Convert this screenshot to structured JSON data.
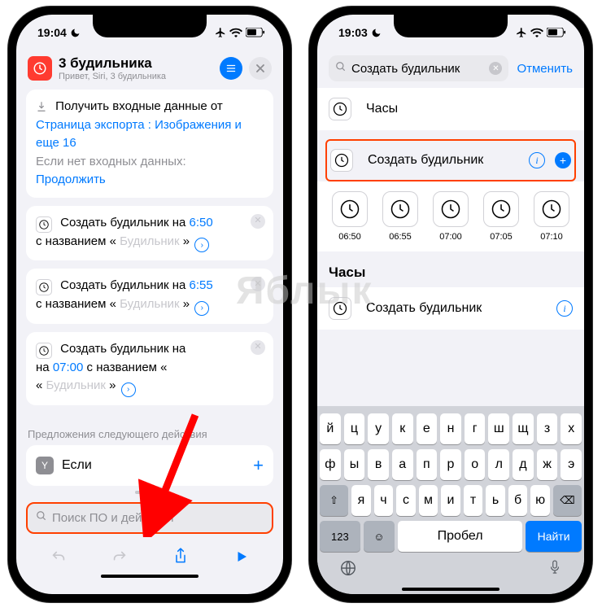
{
  "phone1": {
    "status_time": "19:04",
    "title": "3 будильника",
    "subtitle": "Привет, Siri, 3 будильника",
    "card_intro": {
      "label_get": "Получить входные данные от",
      "source": "Страница экспорта",
      "sep": ":",
      "types": "Изображения и еще 16",
      "no_input": "Если нет входных данных:",
      "cont": "Продолжить"
    },
    "alarm_cards": [
      {
        "pre": "Создать будильник на",
        "time": "6:50",
        "mid": "с названием «",
        "name": "Будильник",
        "end": "»"
      },
      {
        "pre": "Создать будильник на",
        "time": "6:55",
        "mid": "с названием «",
        "name": "Будильник",
        "end": "»"
      },
      {
        "pre": "Создать будильник на",
        "time": "07:00",
        "mid": "с названием «",
        "name": "Будильник",
        "end": "»",
        "na_word": "на"
      }
    ],
    "sugg_label": "Предложения следующего действия",
    "sugg_item": "Если",
    "search_ph": "Поиск ПО и действий"
  },
  "phone2": {
    "status_time": "19:03",
    "search_value": "Создать будильник",
    "cancel": "Отменить",
    "row1": "Часы",
    "row2": "Создать будильник",
    "times": [
      "06:50",
      "06:55",
      "07:00",
      "07:05",
      "07:10"
    ],
    "section": "Часы",
    "row3": "Создать будильник",
    "keyboard": {
      "row1": [
        "й",
        "ц",
        "у",
        "к",
        "е",
        "н",
        "г",
        "ш",
        "щ",
        "з",
        "х"
      ],
      "row2": [
        "ф",
        "ы",
        "в",
        "а",
        "п",
        "р",
        "о",
        "л",
        "д",
        "ж",
        "э"
      ],
      "row3": [
        "я",
        "ч",
        "с",
        "м",
        "и",
        "т",
        "ь",
        "б",
        "ю"
      ],
      "num": "123",
      "space": "Пробел",
      "find": "Найти"
    }
  },
  "watermark": "Яблык"
}
